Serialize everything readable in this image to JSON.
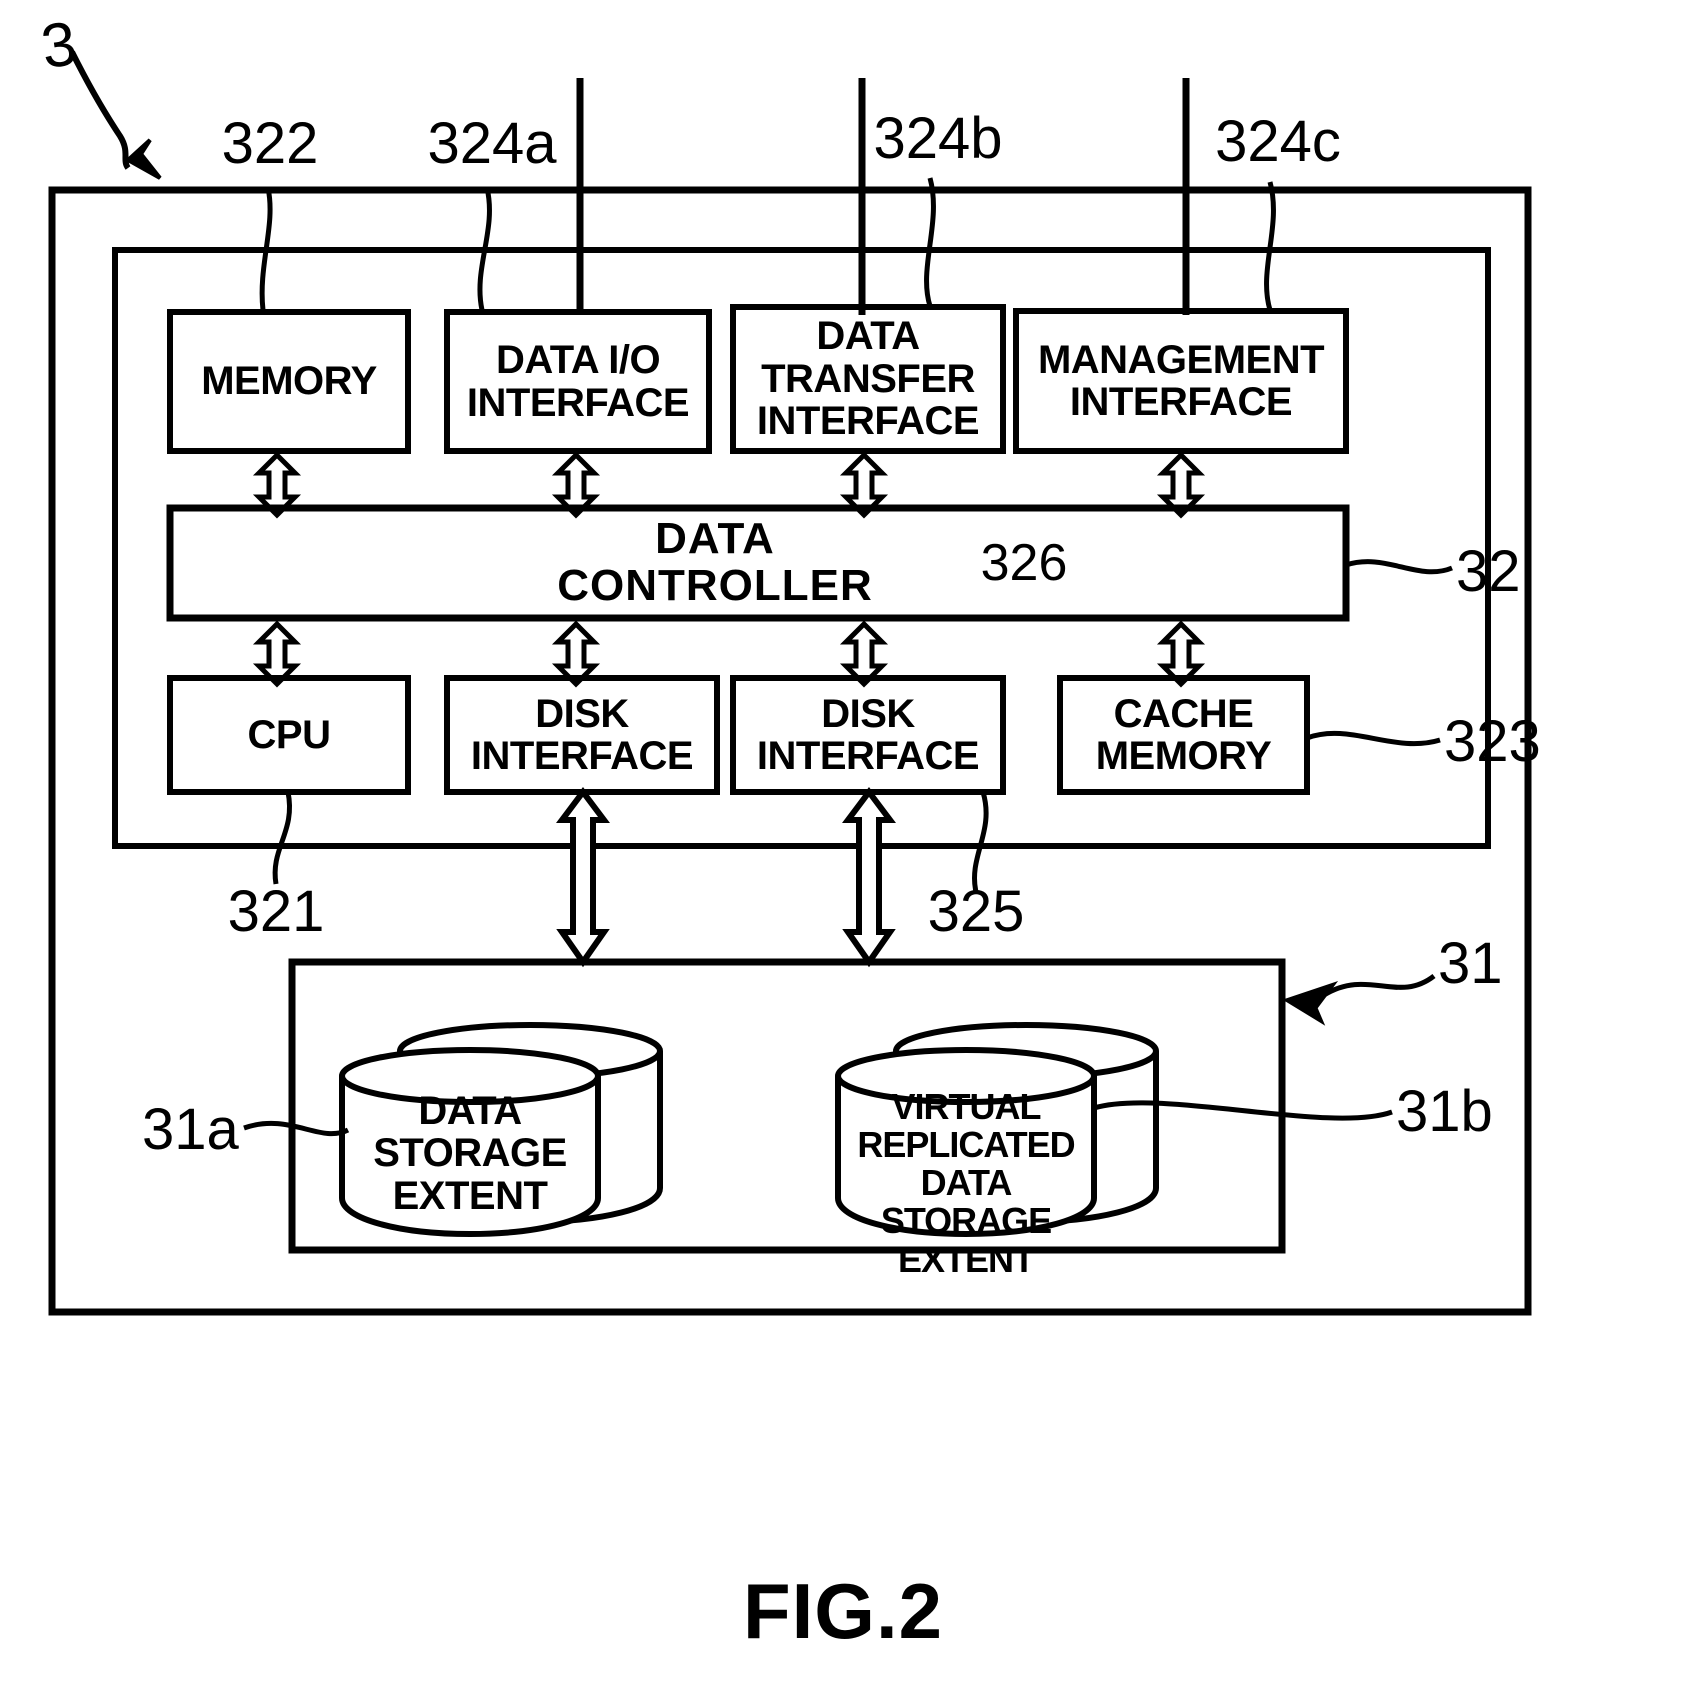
{
  "figure": {
    "caption": "FIG.2",
    "system_ref": "3"
  },
  "reference_numerals": {
    "memory": "322",
    "data_io_interface": "324a",
    "data_transfer_interface": "324b",
    "management_interface": "324c",
    "controller_unit": "32",
    "data_controller": "326",
    "cache_memory": "323",
    "cpu": "321",
    "disk_interface": "325",
    "storage_unit": "31",
    "data_storage_extent": "31a",
    "virtual_replicated_data_storage_extent": "31b"
  },
  "blocks": {
    "memory": "MEMORY",
    "data_io_interface": "DATA I/O\nINTERFACE",
    "data_transfer_interface": "DATA\nTRANSFER\nINTERFACE",
    "management_interface": "MANAGEMENT\nINTERFACE",
    "data_controller": "DATA CONTROLLER",
    "cpu": "CPU",
    "disk_interface_1": "DISK\nINTERFACE",
    "disk_interface_2": "DISK\nINTERFACE",
    "cache_memory": "CACHE\nMEMORY",
    "data_storage_extent": "DATA\nSTORAGE\nEXTENT",
    "virtual_replicated_data_storage_extent": "VIRTUAL\nREPLICATED DATA\nSTORAGE EXTENT"
  },
  "colors": {
    "stroke": "#000000",
    "background": "#ffffff"
  }
}
